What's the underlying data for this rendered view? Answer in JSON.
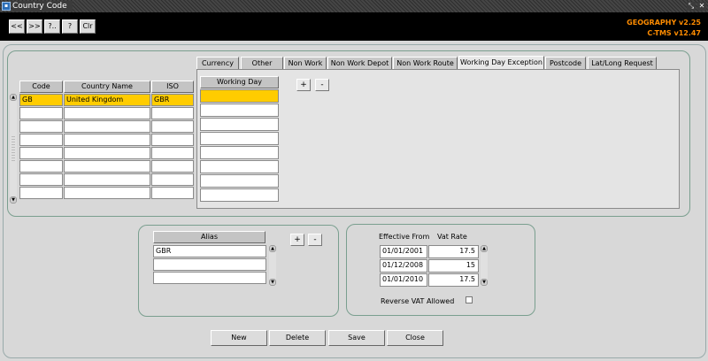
{
  "window": {
    "title": "Country Code",
    "icon": "app-icon"
  },
  "toolbar": {
    "buttons": [
      "<<",
      ">>",
      "?..",
      "?",
      "Clr"
    ],
    "app_version": "GEOGRAPHY v2.25",
    "platform_version": "C-TMS v12.47"
  },
  "tabs": [
    {
      "label": "Currency",
      "active": false
    },
    {
      "label": "Other",
      "active": false
    },
    {
      "label": "Non Work",
      "active": false
    },
    {
      "label": "Non Work Depot",
      "active": false
    },
    {
      "label": "Non Work Route",
      "active": false
    },
    {
      "label": "Working Day Exception",
      "active": true
    },
    {
      "label": "Postcode",
      "active": false
    },
    {
      "label": "Lat/Long Request",
      "active": false
    }
  ],
  "country_table": {
    "headers": {
      "code": "Code",
      "name": "Country Name",
      "iso": "ISO"
    },
    "rows": [
      {
        "code": "GB",
        "name": "United Kingdom",
        "iso": "GBR"
      },
      {
        "code": "",
        "name": "",
        "iso": ""
      },
      {
        "code": "",
        "name": "",
        "iso": ""
      },
      {
        "code": "",
        "name": "",
        "iso": ""
      },
      {
        "code": "",
        "name": "",
        "iso": ""
      },
      {
        "code": "",
        "name": "",
        "iso": ""
      },
      {
        "code": "",
        "name": "",
        "iso": ""
      },
      {
        "code": "",
        "name": "",
        "iso": ""
      }
    ]
  },
  "working_day": {
    "header": "Working Day",
    "rows": [
      "",
      "",
      "",
      "",
      "",
      "",
      "",
      ""
    ],
    "add_label": "+",
    "remove_label": "-"
  },
  "alias": {
    "header": "Alias",
    "rows": [
      "GBR",
      "",
      ""
    ],
    "add_label": "+",
    "remove_label": "-"
  },
  "vat": {
    "effective_from_label": "Effective From",
    "vat_rate_label": "Vat Rate",
    "rows": [
      {
        "date": "01/01/2001",
        "rate": "17.5"
      },
      {
        "date": "01/12/2008",
        "rate": "15"
      },
      {
        "date": "01/01/2010",
        "rate": "17.5"
      }
    ],
    "reverse_vat_label": "Reverse VAT Allowed",
    "reverse_vat_checked": false
  },
  "actions": {
    "new": "New",
    "delete": "Delete",
    "save": "Save",
    "close": "Close"
  },
  "colors": {
    "selected_row": "#ffcc00",
    "version_text": "#ff8c00",
    "toolbar_bg": "#000000",
    "panel_border": "#7a9f8f"
  }
}
